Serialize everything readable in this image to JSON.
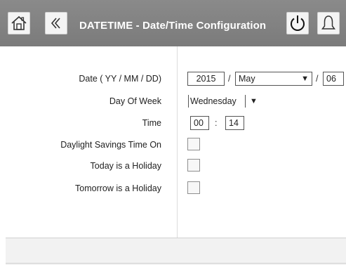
{
  "header": {
    "title": "DATETIME - Date/Time Configuration",
    "icons": [
      "home-icon",
      "back-icon",
      "power-icon",
      "alarm-bell-icon"
    ]
  },
  "form": {
    "date_label": "Date ( YY / MM / DD)",
    "date_year": "2015",
    "date_sep1": "/",
    "date_month": "May",
    "date_sep2": "/",
    "date_day": "06",
    "dow_label": "Day Of Week",
    "dow_value": "Wednesday",
    "time_label": "Time",
    "time_hour": "00",
    "time_sep": ":",
    "time_minute": "14",
    "dst_label": "Daylight Savings Time On",
    "today_holiday_label": "Today is a Holiday",
    "tomorrow_holiday_label": "Tomorrow is a Holiday",
    "dropdown_arrow": "▼"
  },
  "colors": {
    "header_bg": "#7f7f7f",
    "header_text": "#ffffff"
  }
}
